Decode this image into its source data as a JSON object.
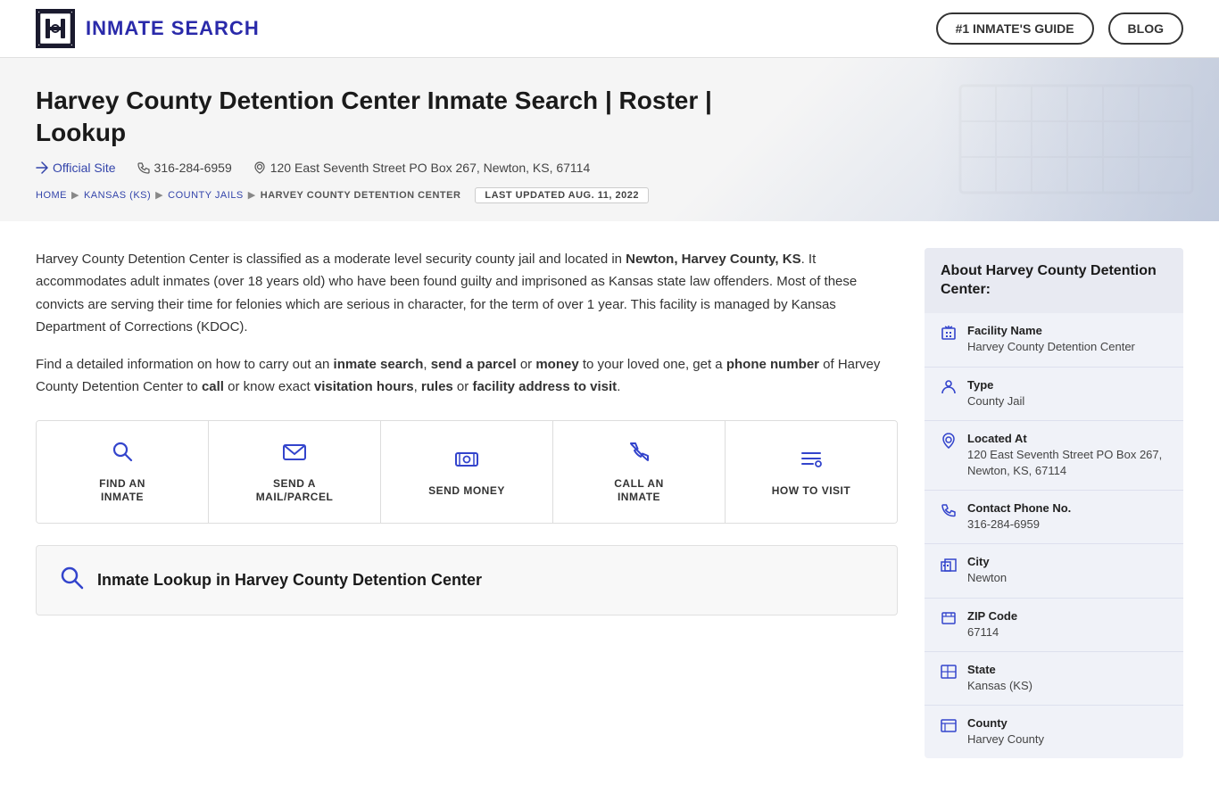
{
  "header": {
    "logo_text": "INMATE SEARCH",
    "nav_guide": "#1 INMATE'S GUIDE",
    "nav_blog": "BLOG"
  },
  "hero": {
    "title": "Harvey County Detention Center Inmate Search | Roster | Lookup",
    "official_site": "Official Site",
    "phone": "316-284-6959",
    "address": "120 East Seventh Street PO Box 267, Newton, KS, 67114",
    "breadcrumb": {
      "home": "HOME",
      "state": "KANSAS (KS)",
      "category": "COUNTY JAILS",
      "current": "HARVEY COUNTY DETENTION CENTER"
    },
    "last_updated": "LAST UPDATED AUG. 11, 2022"
  },
  "description": {
    "paragraph1": "Harvey County Detention Center is classified as a moderate level security county jail and located in Newton, Harvey County, KS. It accommodates adult inmates (over 18 years old) who have been found guilty and imprisoned as Kansas state law offenders. Most of these convicts are serving their time for felonies which are serious in character, for the term of over 1 year. This facility is managed by Kansas Department of Corrections (KDOC).",
    "paragraph1_bold": "Newton, Harvey County, KS",
    "paragraph2_prefix": "Find a detailed information on how to carry out an ",
    "inmate_search": "inmate search",
    "send_a_parcel": "send a parcel",
    "paragraph2_mid": " or ",
    "money": "money",
    "paragraph2_mid2": " to your loved one, get a ",
    "phone_number": "phone number",
    "paragraph2_mid3": " of Harvey County Detention Center to ",
    "call": "call",
    "paragraph2_mid4": " or know exact ",
    "visitation_hours": "visitation hours",
    "rules": "rules",
    "paragraph2_mid5": " or ",
    "facility_address": "facility address to visit",
    "paragraph2_suffix": "."
  },
  "action_tiles": [
    {
      "id": "find-inmate",
      "label": "FIND AN\nINMATE",
      "icon": "search"
    },
    {
      "id": "send-mail",
      "label": "SEND A\nMAIL/PARCEL",
      "icon": "mail"
    },
    {
      "id": "send-money",
      "label": "SEND MONEY",
      "icon": "money"
    },
    {
      "id": "call-inmate",
      "label": "CALL AN\nINMATE",
      "icon": "phone"
    },
    {
      "id": "how-to-visit",
      "label": "HOW TO VISIT",
      "icon": "visit"
    }
  ],
  "inmate_lookup": {
    "title": "Inmate Lookup in Harvey County Detention Center"
  },
  "sidebar": {
    "title": "About Harvey County Detention Center:",
    "fields": [
      {
        "icon": "building",
        "label": "Facility Name",
        "value": "Harvey County Detention Center"
      },
      {
        "icon": "person",
        "label": "Type",
        "value": "County Jail"
      },
      {
        "icon": "location",
        "label": "Located At",
        "value": "120 East Seventh Street PO Box 267,\nNewton, KS, 67114"
      },
      {
        "icon": "phone",
        "label": "Contact Phone No.",
        "value": "316-284-6959"
      },
      {
        "icon": "building2",
        "label": "City",
        "value": "Newton"
      },
      {
        "icon": "mail",
        "label": "ZIP Code",
        "value": "67114"
      },
      {
        "icon": "map",
        "label": "State",
        "value": "Kansas (KS)"
      },
      {
        "icon": "doc",
        "label": "County",
        "value": "Harvey County"
      }
    ]
  }
}
